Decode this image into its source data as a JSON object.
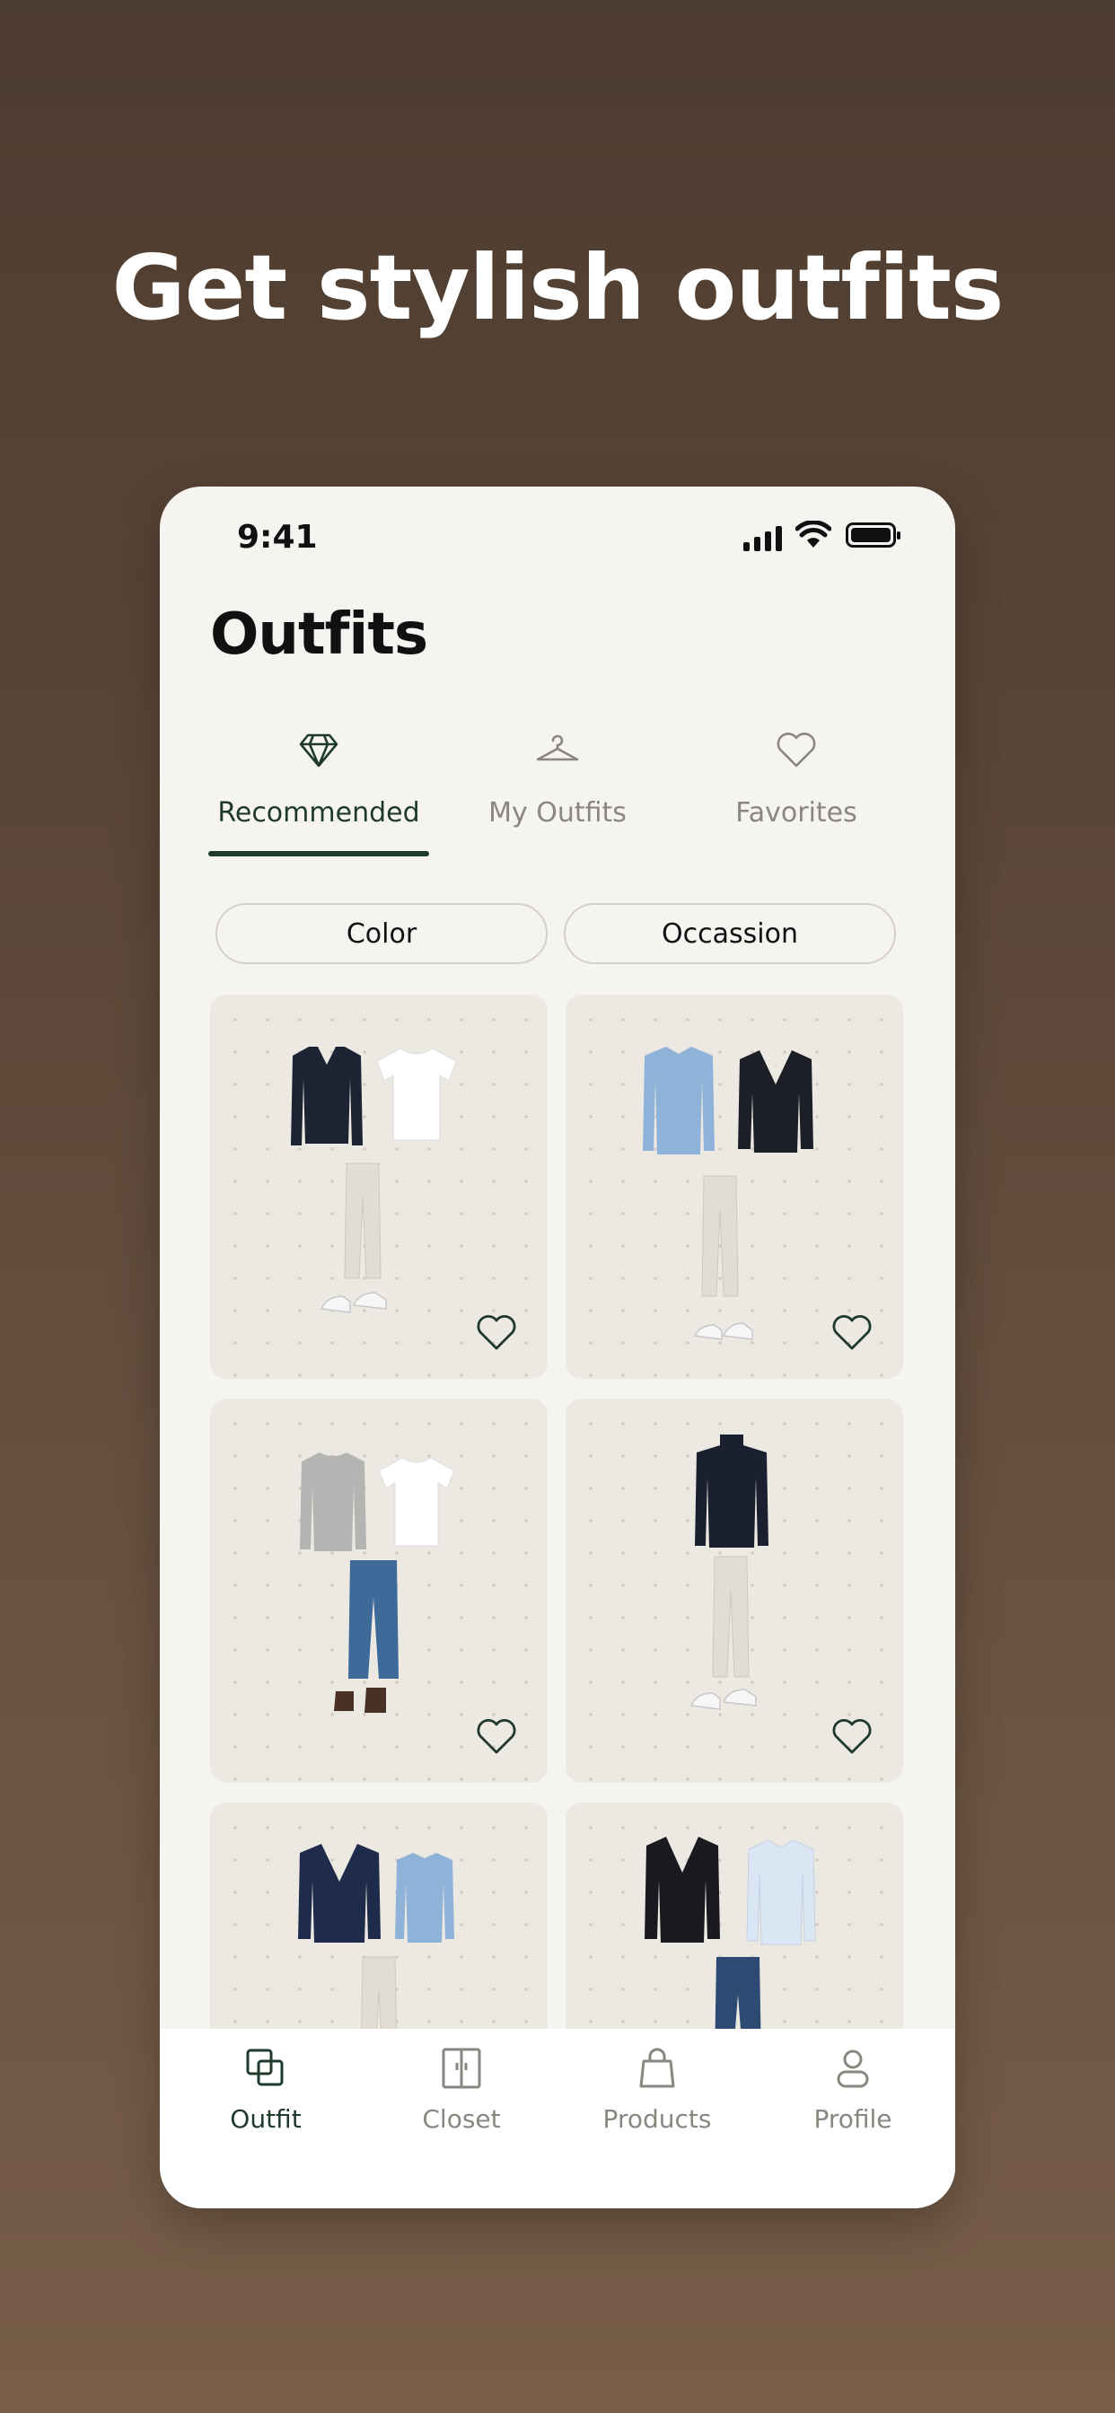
{
  "headline": "Get stylish outfits",
  "status_bar": {
    "time": "9:41"
  },
  "page_title": "Outfits",
  "tabs": [
    {
      "label": "Recommended",
      "icon": "diamond-icon",
      "active": true
    },
    {
      "label": "My Outfits",
      "icon": "hanger-icon",
      "active": false
    },
    {
      "label": "Favorites",
      "icon": "heart-icon",
      "active": false
    }
  ],
  "filters": [
    {
      "label": "Color"
    },
    {
      "label": "Occassion"
    }
  ],
  "outfits": [
    {
      "items": [
        "navy v-neck sweater",
        "white t-shirt",
        "cream trousers",
        "white sneakers"
      ]
    },
    {
      "items": [
        "light blue shirt",
        "navy blazer",
        "cream trousers",
        "white sneakers"
      ]
    },
    {
      "items": [
        "grey sweater",
        "white t-shirt",
        "blue jeans",
        "brown chelsea boots"
      ]
    },
    {
      "items": [
        "navy turtleneck",
        "cream trousers",
        "white sneakers"
      ]
    },
    {
      "items": [
        "navy cardigan",
        "light blue shirt",
        "cream trousers"
      ]
    },
    {
      "items": [
        "black blazer",
        "white shirt",
        "blue jeans"
      ]
    }
  ],
  "bottom_nav": [
    {
      "label": "Outfit",
      "icon": "outfit-icon",
      "active": true
    },
    {
      "label": "Closet",
      "icon": "closet-icon",
      "active": false
    },
    {
      "label": "Products",
      "icon": "bag-icon",
      "active": false
    },
    {
      "label": "Profile",
      "icon": "profile-icon",
      "active": false
    }
  ],
  "colors": {
    "accent": "#1f3a2b",
    "background": "#5d4839",
    "screen": "#f6f4f1",
    "card": "#ece8e2"
  }
}
